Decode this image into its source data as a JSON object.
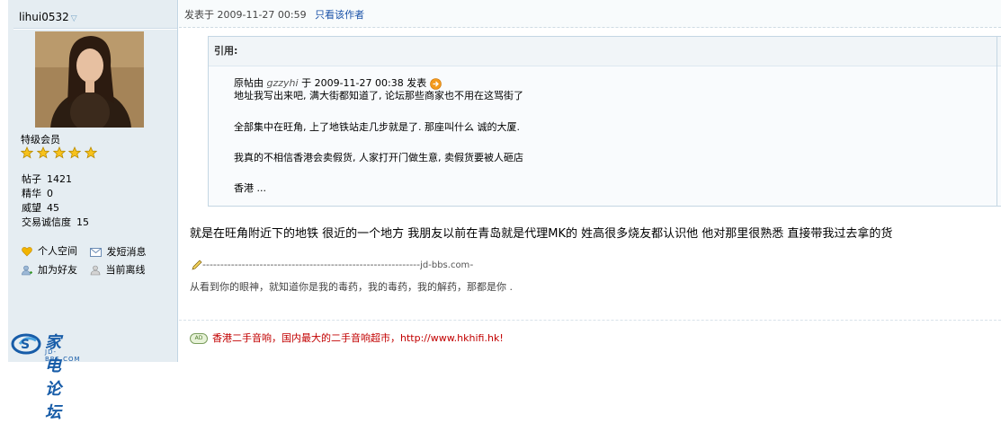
{
  "sidebar": {
    "username": "lihui0532",
    "rank": "特级会员",
    "stars": 5,
    "stats": [
      {
        "label": "帖子",
        "value": "1421"
      },
      {
        "label": "精华",
        "value": "0"
      },
      {
        "label": "威望",
        "value": "45"
      },
      {
        "label": "交易诚信度",
        "value": "15"
      }
    ],
    "actions": {
      "space": "个人空间",
      "message": "发短消息",
      "add_friend": "加为好友",
      "status": "当前离线"
    },
    "brand": {
      "title": "家电论坛",
      "sub": "JD-BBS.COM"
    }
  },
  "post": {
    "posted_label": "发表于",
    "posted_time": "2009-11-27 00:59",
    "author_only": "只看该作者",
    "quote": {
      "header": "引用:",
      "orig_prefix": "原帖由",
      "orig_author": "gzzyhi",
      "orig_mid": "于",
      "orig_time": "2009-11-27 00:38",
      "orig_suffix": "发表",
      "lines": [
        "地址我写出来吧, 满大街都知道了, 论坛那些商家也不用在这骂街了",
        "全部集中在旺角, 上了地铁站走几步就是了. 那座叫什么  诚的大厦.",
        "我真的不相信香港会卖假货, 人家打开门做生意, 卖假货要被人砸店",
        "香港  ..."
      ]
    },
    "reply_text": "就是在旺角附近下的地铁  很近的一个地方  我朋友以前在青岛就是代理MK的  姓高很多烧友都认识他  他对那里很熟悉  直接带我过去拿的货",
    "sig_watermark": "jd-bbs.com",
    "signature": "从看到你的眼神，就知道你是我的毒药，我的毒药，我的解药，那都是你 .",
    "ad": {
      "badge": "AD",
      "text": "香港二手音响，国内最大的二手音响超市，",
      "url": "http://www.hkhifi.hk",
      "excl": "!"
    }
  },
  "colors": {
    "sidebar_bg": "#e5edf2",
    "link": "#1a52a8",
    "ad": "#c20000",
    "brand": "#175ca8"
  }
}
